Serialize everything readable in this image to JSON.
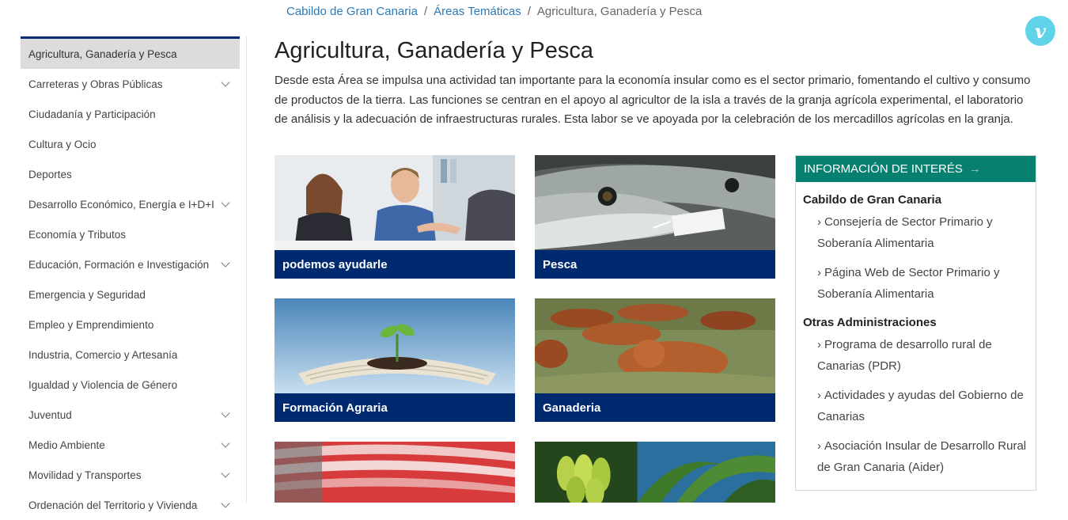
{
  "breadcrumb": {
    "items": [
      "Cabildo de Gran Canaria",
      "Áreas Temáticas"
    ],
    "current": "Agricultura, Ganadería y Pesca",
    "separator": "/"
  },
  "vimeo": {
    "label": "v"
  },
  "sidebar": {
    "items": [
      {
        "label": "Agricultura, Ganadería y Pesca",
        "active": true,
        "expandable": false
      },
      {
        "label": "Carreteras y Obras Públicas",
        "expandable": true
      },
      {
        "label": "Ciudadanía y Participación",
        "expandable": false
      },
      {
        "label": "Cultura y Ocio",
        "expandable": false
      },
      {
        "label": "Deportes",
        "expandable": false
      },
      {
        "label": "Desarrollo Económico, Energía e I+D+I",
        "expandable": true
      },
      {
        "label": "Economía y Tributos",
        "expandable": false
      },
      {
        "label": "Educación, Formación e Investigación",
        "expandable": true
      },
      {
        "label": "Emergencia y Seguridad",
        "expandable": false
      },
      {
        "label": "Empleo y Emprendimiento",
        "expandable": false
      },
      {
        "label": "Industria, Comercio y Artesanía",
        "expandable": false
      },
      {
        "label": "Igualdad y Violencia de Género",
        "expandable": false
      },
      {
        "label": "Juventud",
        "expandable": true
      },
      {
        "label": "Medio Ambiente",
        "expandable": true
      },
      {
        "label": "Movilidad y Transportes",
        "expandable": true
      },
      {
        "label": "Ordenación del Territorio y Vivienda",
        "expandable": true
      }
    ]
  },
  "page": {
    "title": "Agricultura, Ganadería y Pesca",
    "intro": "Desde esta Área se impulsa una actividad tan importante para la economía insular como es el sector primario, fomentando el cultivo y consumo de productos de la tierra. Las funciones se centran en el apoyo al agricultor de la isla a través de la granja agrícola experimental, el laboratorio de análisis y la adecuación de infraestructuras rurales. Esta labor se ve apoyada por la celebración de los mercadillos agrícolas en la granja."
  },
  "cards": [
    {
      "label": "podemos ayudarle",
      "image": "business-handshake-photo"
    },
    {
      "label": "Pesca",
      "image": "fish-photo",
      "tag": "acuaql"
    },
    {
      "label": "Formación Agraria",
      "image": "book-sprout-photo"
    },
    {
      "label": "Ganaderia",
      "image": "cattle-photo"
    },
    {
      "label": "",
      "image": "magazines-photo"
    },
    {
      "label": "",
      "image": "bananas-photo"
    }
  ],
  "info": {
    "header": "INFORMACIÓN DE INTERÉS",
    "arrow": "→",
    "sections": [
      {
        "title": "Cabildo de Gran Canaria",
        "links": [
          "Consejería de Sector Primario y Soberanía Alimentaria",
          "Página Web de Sector Primario y Soberanía Alimentaria"
        ]
      },
      {
        "title": "Otras Administraciones",
        "links": [
          "Programa de desarrollo rural de Canarias (PDR)",
          "Actividades y ayudas del Gobierno de Canarias",
          "Asociación Insular de Desarrollo Rural de Gran Canaria (Aider)"
        ]
      }
    ]
  },
  "colors": {
    "brand_navy": "#002a70",
    "accent_teal": "#078070",
    "link_blue": "#2a7ab8",
    "vimeo": "#5fd3e7"
  }
}
